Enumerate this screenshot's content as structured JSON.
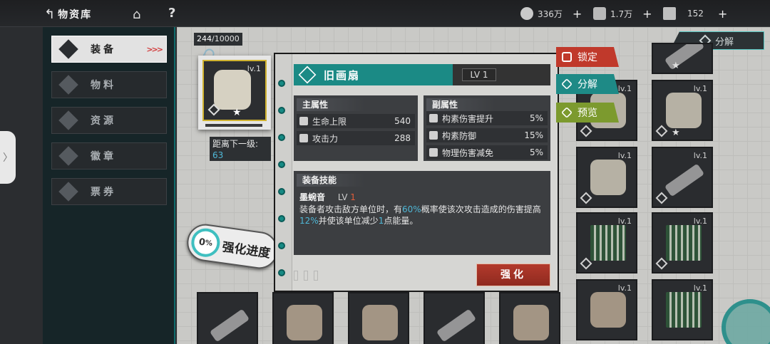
{
  "topbar": {
    "title": "物资库",
    "resources": [
      {
        "icon": "coin-icon",
        "value": "336万"
      },
      {
        "icon": "material-icon",
        "value": "1.7万"
      },
      {
        "icon": "ticket-icon",
        "value": "152"
      }
    ]
  },
  "sidebar": {
    "items": [
      {
        "label": "装备",
        "icon": "equipment-icon",
        "active": true
      },
      {
        "label": "物料",
        "icon": "material-icon"
      },
      {
        "label": "资源",
        "icon": "resource-icon"
      },
      {
        "label": "徽章",
        "icon": "badge-icon"
      },
      {
        "label": "票券",
        "icon": "ticket-icon"
      }
    ]
  },
  "inventory": {
    "count": "244",
    "capacity": "/10000",
    "decompose_label": "分解",
    "cells": [
      {
        "lv": "lv.1"
      },
      {
        "lv": "lv.1"
      },
      {
        "lv": "lv.1"
      },
      {
        "lv": "lv.1"
      },
      {
        "lv": "lv.1"
      },
      {
        "lv": "lv.1"
      },
      {
        "lv": "lv.1"
      },
      {
        "lv": "lv.1"
      }
    ]
  },
  "selected": {
    "lv": "lv.1",
    "next_level_label": "距离下一级:",
    "next_level_value": "63",
    "enhance_progress": "0",
    "enhance_progress_unit": "%",
    "enhance_progress_label": "强化进度"
  },
  "detail": {
    "name": "旧画扇",
    "lv": "LV 1",
    "main_attr_title": "主属性",
    "main_attrs": [
      {
        "label": "生命上限",
        "value": "540",
        "icon": "heart-icon"
      },
      {
        "label": "攻击力",
        "value": "288",
        "icon": "swords-icon"
      }
    ],
    "sub_attr_title": "副属性",
    "sub_attrs": [
      {
        "label": "构素伤害提升",
        "value": "5%",
        "icon": "element-damage-icon"
      },
      {
        "label": "构素防御",
        "value": "15%",
        "icon": "element-defense-icon"
      },
      {
        "label": "物理伤害减免",
        "value": "5%",
        "icon": "physical-reduction-icon"
      }
    ],
    "skill_title": "装备技能",
    "skill_name": "墨蜿音",
    "skill_lv_prefix": "LV",
    "skill_lv": "1",
    "skill_desc": {
      "p1": "装备者攻击敌方单位时，有",
      "v1": "60%",
      "p2": "概率使该次攻击造成的伤害提高",
      "v2": "12%",
      "p3": "并使该单位减少",
      "v3": "1",
      "p4": "点能量。"
    },
    "enhance_button": "强化"
  },
  "actions": {
    "lock": "锁定",
    "decompose": "分解",
    "preview": "预览"
  },
  "colors": {
    "accent_teal": "#1b8a85",
    "lock_red": "#c0392b",
    "preview_green": "#7c9a2e",
    "highlight_blue": "#4fb7d6"
  }
}
